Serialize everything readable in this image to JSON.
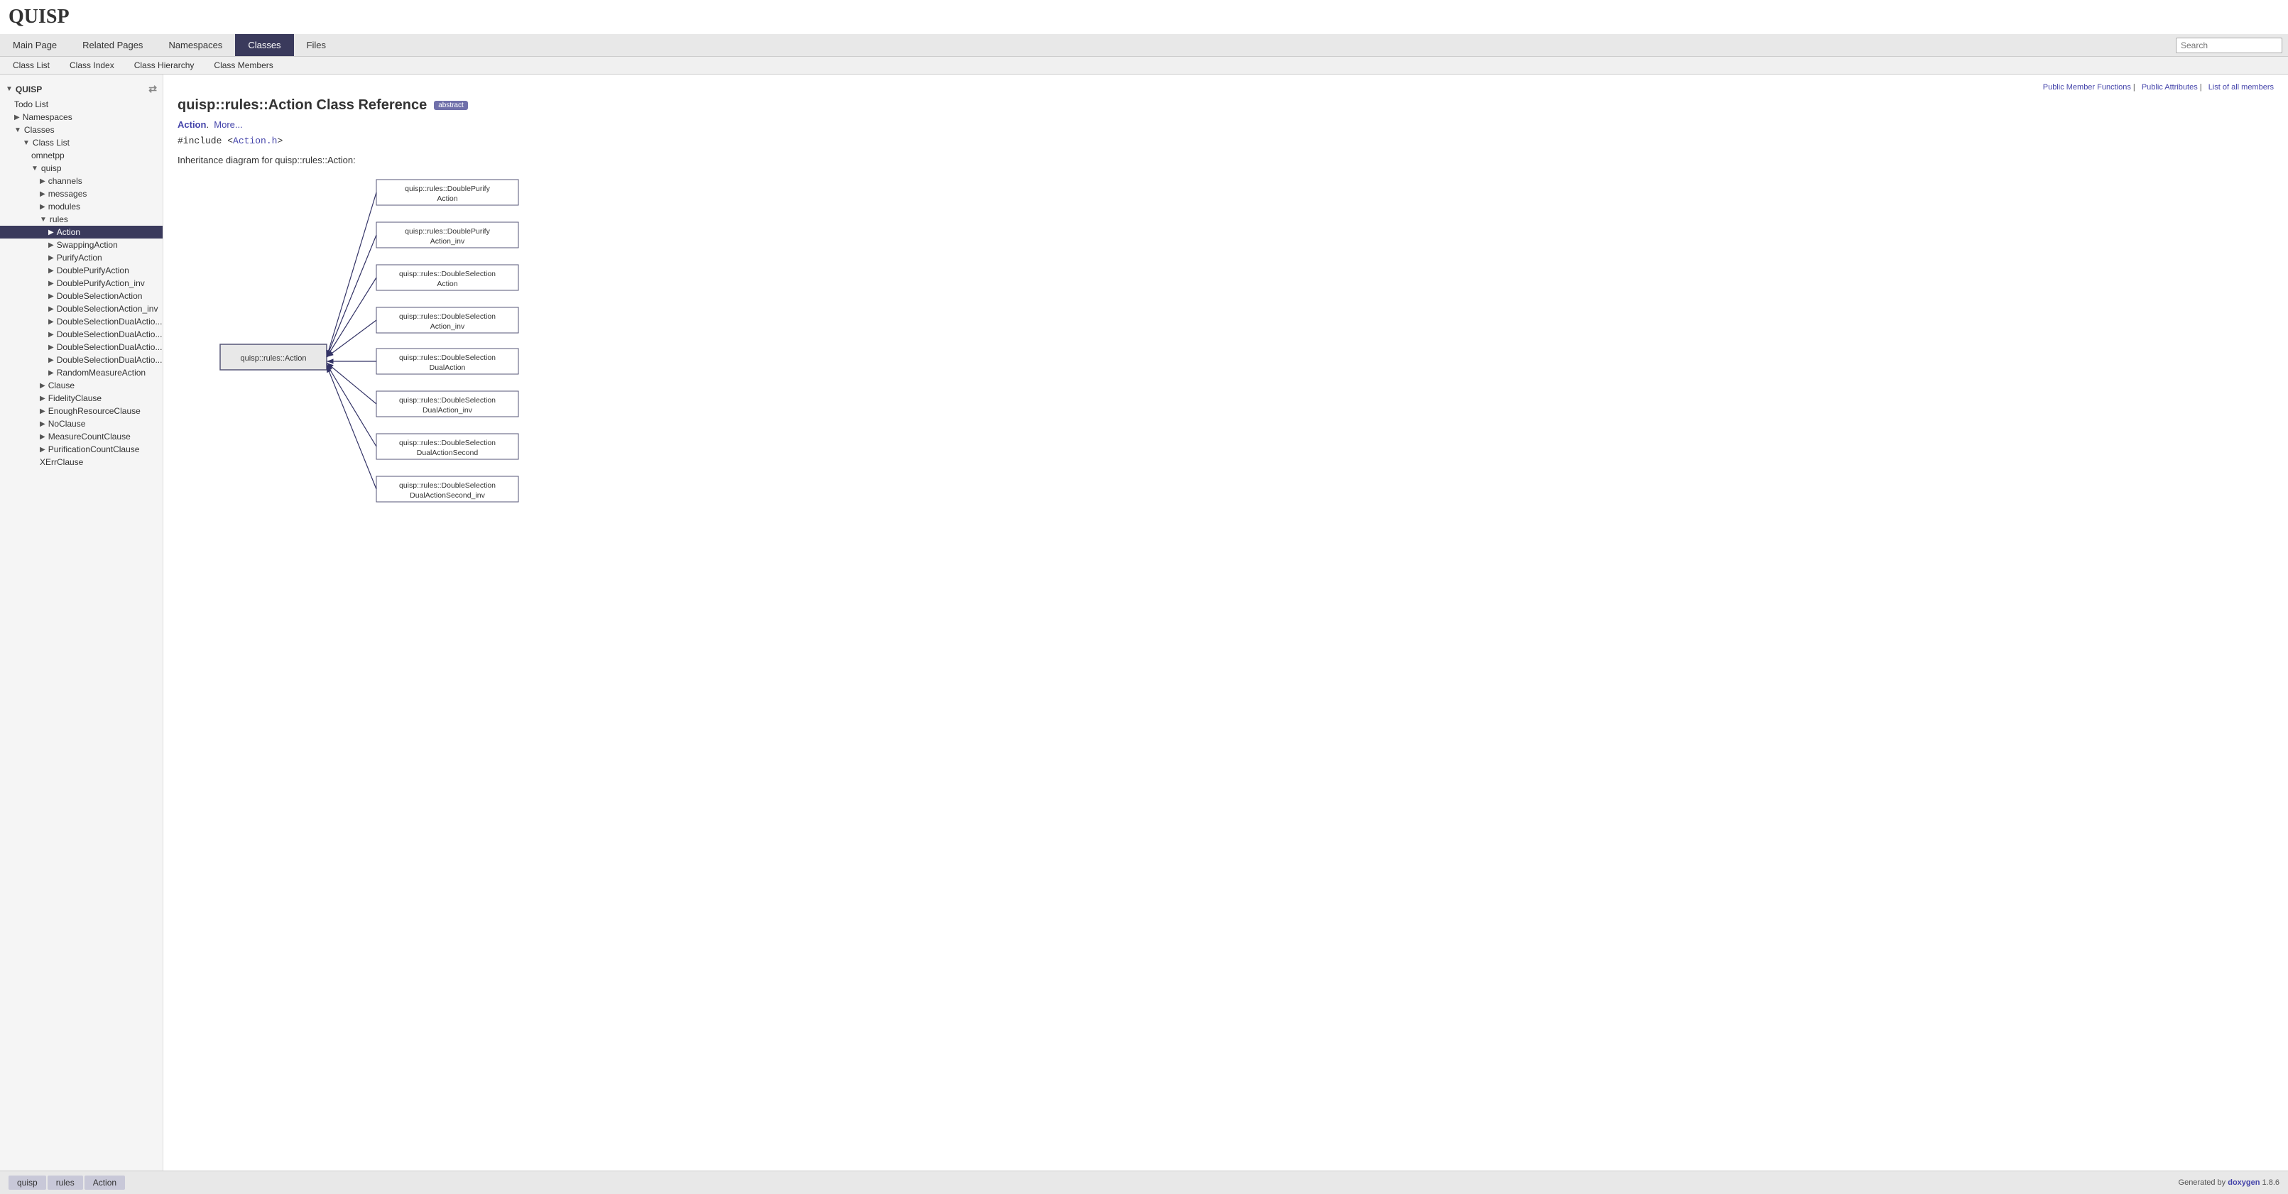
{
  "header": {
    "title": "QUISP"
  },
  "main_nav": {
    "items": [
      {
        "label": "Main Page",
        "active": false
      },
      {
        "label": "Related Pages",
        "active": false
      },
      {
        "label": "Namespaces",
        "active": false
      },
      {
        "label": "Classes",
        "active": true
      },
      {
        "label": "Files",
        "active": false
      }
    ],
    "search_placeholder": "Search"
  },
  "sub_nav": {
    "items": [
      {
        "label": "Class List"
      },
      {
        "label": "Class Index"
      },
      {
        "label": "Class Hierarchy"
      },
      {
        "label": "Class Members"
      }
    ]
  },
  "sidebar": {
    "root": "QUISP",
    "items": [
      {
        "label": "Todo List",
        "indent": 1,
        "arrow": false
      },
      {
        "label": "Namespaces",
        "indent": 1,
        "arrow": true
      },
      {
        "label": "Classes",
        "indent": 1,
        "arrow": true,
        "expanded": true
      },
      {
        "label": "Class List",
        "indent": 2,
        "arrow": true,
        "expanded": true
      },
      {
        "label": "omnetpp",
        "indent": 3,
        "arrow": false
      },
      {
        "label": "quisp",
        "indent": 3,
        "arrow": true,
        "expanded": true
      },
      {
        "label": "channels",
        "indent": 4,
        "arrow": true
      },
      {
        "label": "messages",
        "indent": 4,
        "arrow": true
      },
      {
        "label": "modules",
        "indent": 4,
        "arrow": true
      },
      {
        "label": "rules",
        "indent": 4,
        "arrow": true,
        "expanded": true
      },
      {
        "label": "Action",
        "indent": 5,
        "active": true
      },
      {
        "label": "SwappingAction",
        "indent": 5,
        "arrow": true
      },
      {
        "label": "PurifyAction",
        "indent": 5,
        "arrow": true
      },
      {
        "label": "DoublePurifyAction",
        "indent": 5,
        "arrow": true
      },
      {
        "label": "DoublePurifyAction_inv",
        "indent": 5,
        "arrow": true
      },
      {
        "label": "DoubleSelectionAction",
        "indent": 5,
        "arrow": true
      },
      {
        "label": "DoubleSelectionAction_inv",
        "indent": 5,
        "arrow": true
      },
      {
        "label": "DoubleSelectionDualActio...",
        "indent": 5,
        "arrow": true
      },
      {
        "label": "DoubleSelectionDualActio...",
        "indent": 5,
        "arrow": true
      },
      {
        "label": "DoubleSelectionDualActio...",
        "indent": 5,
        "arrow": true
      },
      {
        "label": "DoubleSelectionDualActio...",
        "indent": 5,
        "arrow": true
      },
      {
        "label": "RandomMeasureAction",
        "indent": 5,
        "arrow": true
      },
      {
        "label": "Clause",
        "indent": 4,
        "arrow": true
      },
      {
        "label": "FidelityClause",
        "indent": 4,
        "arrow": true
      },
      {
        "label": "EnoughResourceClause",
        "indent": 4,
        "arrow": true
      },
      {
        "label": "NoClause",
        "indent": 4,
        "arrow": true
      },
      {
        "label": "MeasureCountClause",
        "indent": 4,
        "arrow": true
      },
      {
        "label": "PurificationCountClause",
        "indent": 4,
        "arrow": true
      },
      {
        "label": "XErrClause",
        "indent": 4,
        "arrow": false
      }
    ]
  },
  "page": {
    "title": "quisp::rules::Action Class Reference",
    "badge": "abstract",
    "action_link": "Action",
    "more_link": "More...",
    "include_text": "#include <Action.h>",
    "include_file": "Action.h",
    "diagram_label": "Inheritance diagram for quisp::rules::Action:",
    "top_links": [
      {
        "label": "Public Member Functions"
      },
      {
        "label": "Public Attributes"
      },
      {
        "label": "List of all members"
      }
    ]
  },
  "diagram": {
    "center_node": "quisp::rules::Action",
    "child_nodes": [
      "quisp::rules::DoublePurify\nAction",
      "quisp::rules::DoublePurify\nAction_inv",
      "quisp::rules::DoubleSelection\nAction",
      "quisp::rules::DoubleSelection\nAction_inv",
      "quisp::rules::DoubleSelection\nDualAction",
      "quisp::rules::DoubleSelection\nDualAction_inv",
      "quisp::rules::DoubleSelection\nDualActionSecond",
      "quisp::rules::DoubleSelection\nDualActionSecond_inv"
    ]
  },
  "footer": {
    "breadcrumbs": [
      "quisp",
      "rules",
      "Action"
    ],
    "generated_by": "Generated by",
    "doxygen_label": "doxygen",
    "version": "1.8.6"
  }
}
